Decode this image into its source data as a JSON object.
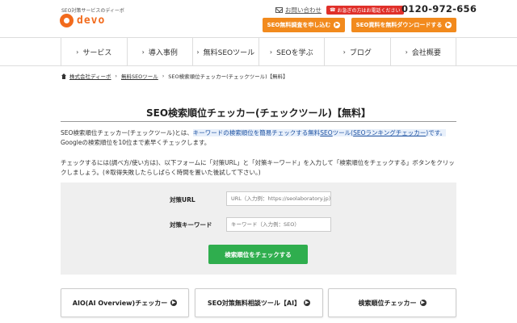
{
  "header": {
    "tagline": "SEO対策サービスのディーボ",
    "logo_text": "devo",
    "contact_label": "お問い合わせ",
    "phone_badge": "お急ぎの方はお電話ください",
    "phone_number": "0120-972-656",
    "btn_diagnosis": "SEO無料調査を申し込む",
    "btn_download": "SEO資料を無料ダウンロードする"
  },
  "nav": {
    "items": [
      {
        "label": "サービス"
      },
      {
        "label": "導入事例"
      },
      {
        "label": "無料SEOツール"
      },
      {
        "label": "SEOを学ぶ"
      },
      {
        "label": "ブログ"
      },
      {
        "label": "会社概要"
      }
    ]
  },
  "breadcrumb": {
    "home": "株式会社ディーボ",
    "tools": "無料SEOツール",
    "current": "SEO検索順位チェッカー(チェックツール)【無料】"
  },
  "main": {
    "title": "SEO検索順位チェッカー(チェックツール)【無料】",
    "intro_prefix": "SEO検索順位チェッカー(チェックツール)とは、",
    "intro_highlight_a": "キーワードの検索順位を簡易チェックする無料",
    "intro_highlight_link": "SEO",
    "intro_highlight_b": "ツール(",
    "intro_highlight_link2": "SEOランキングチェッカー",
    "intro_highlight_c": ")です。",
    "intro_suffix": "Googleの検索順位を10位まで素早くチェックします。",
    "howto": "チェックするには(調べ方/使い方は)、以下フォームに「対策URL」と「対策キーワード」を入力して「検索順位をチェックする」ボタンをクリックしましょう。(※取得失敗したらしばらく時間を置いた後試して下さい。)"
  },
  "form": {
    "url_label": "対策URL",
    "url_placeholder": "URL（入力例：https://seolaboratory.jp）",
    "keyword_label": "対策キーワード",
    "keyword_placeholder": "キーワード（入力例：SEO）",
    "submit_label": "検索順位をチェックする"
  },
  "tools": [
    {
      "label": "AIO(AI Overview)チェッカー"
    },
    {
      "label": "SEO対策無料相談ツール【AI】"
    },
    {
      "label": "検索順位チェッカー"
    }
  ],
  "colors": {
    "accent_orange": "#f28a1d",
    "logo_orange": "#f26b1d",
    "badge_red": "#e0302a",
    "check_green": "#2fae4e"
  }
}
